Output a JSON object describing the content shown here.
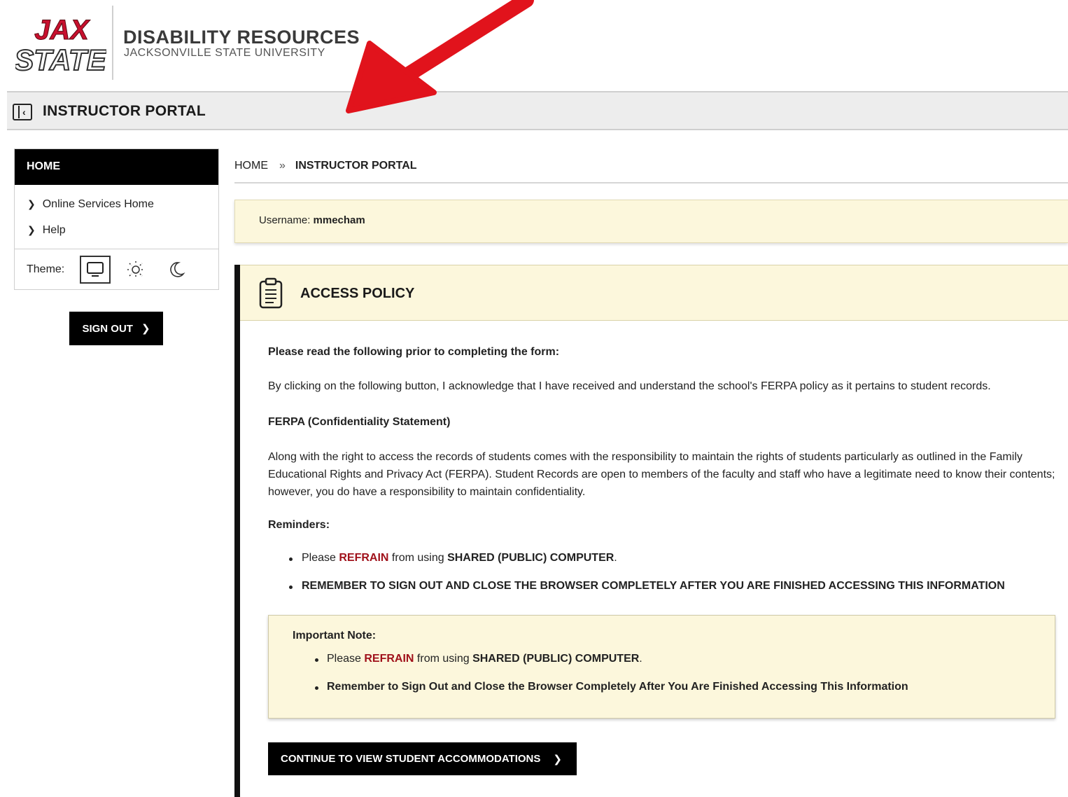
{
  "header": {
    "logo_line1": "JAX",
    "logo_line2": "STATE",
    "org_name": "DISABILITY RESOURCES",
    "org_sub": "JACKSONVILLE STATE UNIVERSITY",
    "brand_color": "#c8102e"
  },
  "portal_bar": {
    "title": "INSTRUCTOR PORTAL"
  },
  "sidebar": {
    "heading": "HOME",
    "items": [
      {
        "label": "Online Services Home"
      },
      {
        "label": "Help"
      }
    ],
    "theme_label": "Theme:",
    "theme_options": [
      "monitor-icon",
      "sun-icon",
      "moon-icon"
    ],
    "selected_theme": "monitor-icon",
    "signout_label": "SIGN OUT"
  },
  "breadcrumb": {
    "home": "HOME",
    "separator": "»",
    "current": "INSTRUCTOR PORTAL"
  },
  "user": {
    "label": "Username:",
    "value": "mmecham"
  },
  "policy": {
    "title": "ACCESS POLICY",
    "intro": "Please read the following prior to completing the form:",
    "acknowledge": "By clicking on the following button, I acknowledge that I have received and understand the school's FERPA policy as it pertains to student records.",
    "ferpa_heading": "FERPA (Confidentiality Statement)",
    "ferpa_text": "Along with the right to access the records of students comes with the responsibility to maintain the rights of students particularly as outlined in the Family Educational Rights and Privacy Act (FERPA). Student Records are open to members of the faculty and staff who have a legitimate need to know their contents; however, you do have a responsibility to maintain confidentiality.",
    "reminders_heading": "Reminders:",
    "reminder1_prefix": "Please ",
    "reminder1_red": "REFRAIN",
    "reminder1_mid": " from using ",
    "reminder1_bold": "SHARED (PUBLIC) COMPUTER",
    "reminder1_end": ".",
    "reminder2": "REMEMBER TO SIGN OUT AND CLOSE THE BROWSER COMPLETELY AFTER YOU ARE FINISHED ACCESSING THIS INFORMATION",
    "note_heading": "Important Note:",
    "note1_prefix": "Please ",
    "note1_red": "REFRAIN",
    "note1_mid": " from using ",
    "note1_bold": "SHARED (PUBLIC) COMPUTER",
    "note1_end": ".",
    "note2": "Remember to Sign Out and Close the Browser Completely After You Are Finished Accessing This Information",
    "continue_label": "CONTINUE TO VIEW STUDENT ACCOMMODATIONS"
  }
}
